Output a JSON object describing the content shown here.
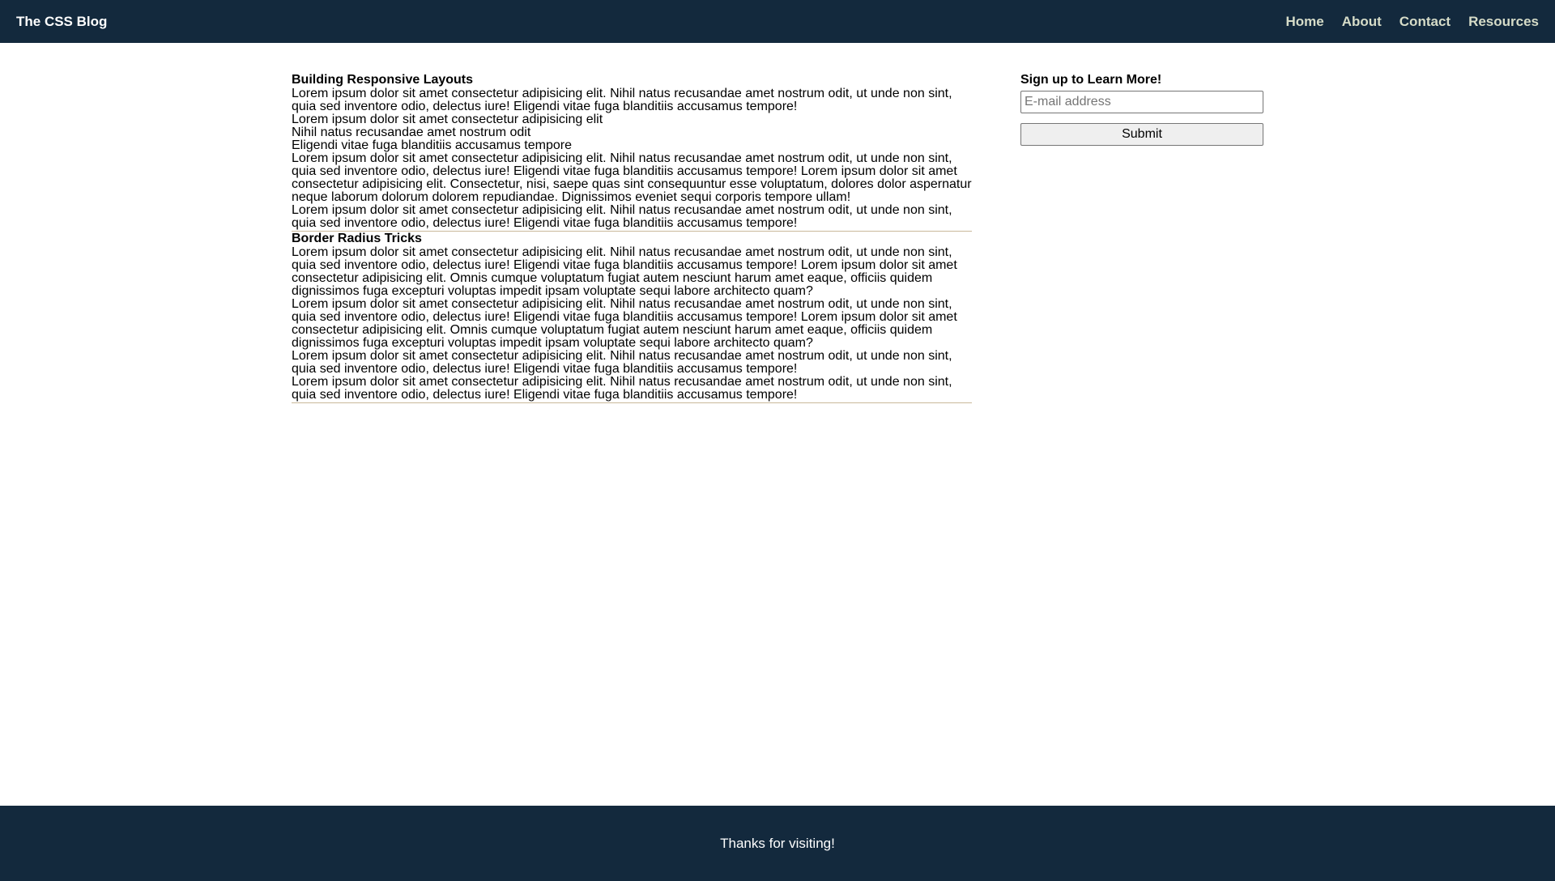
{
  "header": {
    "brand": "The CSS Blog",
    "nav": [
      "Home",
      "About",
      "Contact",
      "Resources"
    ]
  },
  "posts": [
    {
      "title": "Building Responsive Layouts",
      "paragraphs": [
        "Lorem ipsum dolor sit amet consectetur adipisicing elit. Nihil natus recusandae amet nostrum odit, ut unde non sint, quia sed inventore odio, delectus iure! Eligendi vitae fuga blanditiis accusamus tempore!",
        "Lorem ipsum dolor sit amet consectetur adipisicing elit",
        "Nihil natus recusandae amet nostrum odit",
        "Eligendi vitae fuga blanditiis accusamus tempore",
        "Lorem ipsum dolor sit amet consectetur adipisicing elit. Nihil natus recusandae amet nostrum odit, ut unde non sint, quia sed inventore odio, delectus iure! Eligendi vitae fuga blanditiis accusamus tempore! Lorem ipsum dolor sit amet consectetur adipisicing elit. Consectetur, nisi, saepe quas sint consequuntur esse voluptatum, dolores dolor aspernatur neque laborum dolorum dolorem repudiandae. Dignissimos eveniet sequi corporis tempore ullam!",
        "Lorem ipsum dolor sit amet consectetur adipisicing elit. Nihil natus recusandae amet nostrum odit, ut unde non sint, quia sed inventore odio, delectus iure! Eligendi vitae fuga blanditiis accusamus tempore!"
      ]
    },
    {
      "title": "Border Radius Tricks",
      "paragraphs": [
        "Lorem ipsum dolor sit amet consectetur adipisicing elit. Nihil natus recusandae amet nostrum odit, ut unde non sint, quia sed inventore odio, delectus iure! Eligendi vitae fuga blanditiis accusamus tempore! Lorem ipsum dolor sit amet consectetur adipisicing elit. Omnis cumque voluptatum fugiat autem nesciunt harum amet eaque, officiis quidem dignissimos fuga excepturi voluptas impedit ipsam voluptate sequi labore architecto quam?",
        "Lorem ipsum dolor sit amet consectetur adipisicing elit. Nihil natus recusandae amet nostrum odit, ut unde non sint, quia sed inventore odio, delectus iure! Eligendi vitae fuga blanditiis accusamus tempore! Lorem ipsum dolor sit amet consectetur adipisicing elit. Omnis cumque voluptatum fugiat autem nesciunt harum amet eaque, officiis quidem dignissimos fuga excepturi voluptas impedit ipsam voluptate sequi labore architecto quam?",
        "Lorem ipsum dolor sit amet consectetur adipisicing elit. Nihil natus recusandae amet nostrum odit, ut unde non sint, quia sed inventore odio, delectus iure! Eligendi vitae fuga blanditiis accusamus tempore!",
        "Lorem ipsum dolor sit amet consectetur adipisicing elit. Nihil natus recusandae amet nostrum odit, ut unde non sint, quia sed inventore odio, delectus iure! Eligendi vitae fuga blanditiis accusamus tempore!"
      ]
    }
  ],
  "signup": {
    "heading": "Sign up to Learn More!",
    "email_placeholder": "E-mail address",
    "email_value": "",
    "submit_label": "Submit"
  },
  "footer": {
    "text": "Thanks for visiting!"
  },
  "colors": {
    "header_bg": "#13293d",
    "nav_link": "#d6dcc8",
    "divider": "#c9b89a"
  }
}
